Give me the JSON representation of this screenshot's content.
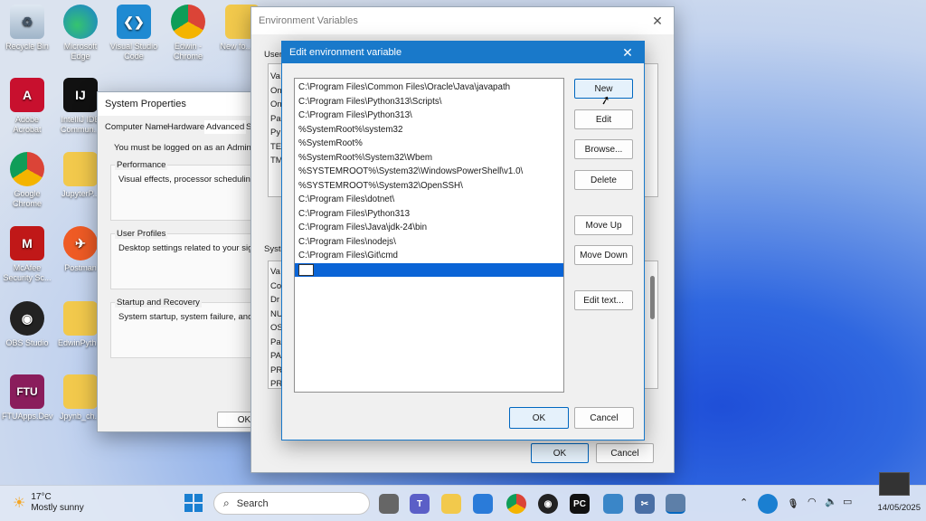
{
  "desktop": {
    "icons": [
      {
        "label": "Recycle Bin"
      },
      {
        "label": "Microsoft Edge"
      },
      {
        "label": "Visual Studio Code"
      },
      {
        "label": "Edwin - Chrome"
      },
      {
        "label": "New fo... (2)"
      },
      {
        "label": "Adobe Acrobat"
      },
      {
        "label": "IntelliJ IDE Commun..."
      },
      {
        "label": "Google Chrome"
      },
      {
        "label": "JupyterP..."
      },
      {
        "label": "McAfee Security Sc..."
      },
      {
        "label": "Postman"
      },
      {
        "label": "OBS Studio"
      },
      {
        "label": "EdwinPyth..."
      },
      {
        "label": "FTUApps.Dev"
      },
      {
        "label": "Jpynb_ch..."
      }
    ]
  },
  "system_properties": {
    "title": "System Properties",
    "tabs": [
      "Computer Name",
      "Hardware",
      "Advanced",
      "S"
    ],
    "notice": "You must be logged on as an Administra",
    "groups": [
      {
        "title": "Performance",
        "desc": "Visual effects, processor scheduling, m"
      },
      {
        "title": "User Profiles",
        "desc": "Desktop settings related to your sign-in"
      },
      {
        "title": "Startup and Recovery",
        "desc": "System startup, system failure, and deb"
      }
    ],
    "ok_label": "OK"
  },
  "env_vars": {
    "title": "Environment Variables",
    "user_label": "User",
    "user_rows": [
      "Va",
      "On",
      "On",
      "Pa",
      "Py",
      "TE",
      "TM"
    ],
    "system_label": "Syste",
    "system_rows": [
      "Va",
      "Co",
      "Dr",
      "NU",
      "OS",
      "Pa",
      "PA",
      "PR",
      "PR"
    ],
    "ok_label": "OK",
    "cancel_label": "Cancel"
  },
  "edit_dialog": {
    "title": "Edit environment variable",
    "paths": [
      "C:\\Program Files\\Common Files\\Oracle\\Java\\javapath",
      "C:\\Program Files\\Python313\\Scripts\\",
      "C:\\Program Files\\Python313\\",
      "%SystemRoot%\\system32",
      "%SystemRoot%",
      "%SystemRoot%\\System32\\Wbem",
      "%SYSTEMROOT%\\System32\\WindowsPowerShell\\v1.0\\",
      "%SYSTEMROOT%\\System32\\OpenSSH\\",
      "C:\\Program Files\\dotnet\\",
      "C:\\Program Files\\Python313",
      "C:\\Program Files\\Java\\jdk-24\\bin",
      "C:\\Program Files\\nodejs\\",
      "C:\\Program Files\\Git\\cmd"
    ],
    "new_entry_value": "",
    "buttons": {
      "new": "New",
      "edit": "Edit",
      "browse": "Browse...",
      "delete": "Delete",
      "move_up": "Move Up",
      "move_down": "Move Down",
      "edit_text": "Edit text...",
      "ok": "OK",
      "cancel": "Cancel"
    }
  },
  "taskbar": {
    "weather_temp": "17°C",
    "weather_desc": "Mostly sunny",
    "search_placeholder": "Search",
    "time": "",
    "date": "14/05/2025"
  },
  "colors": {
    "accent": "#0067c0",
    "selection": "#0a64d6",
    "dialog_border": "#1979ca"
  }
}
